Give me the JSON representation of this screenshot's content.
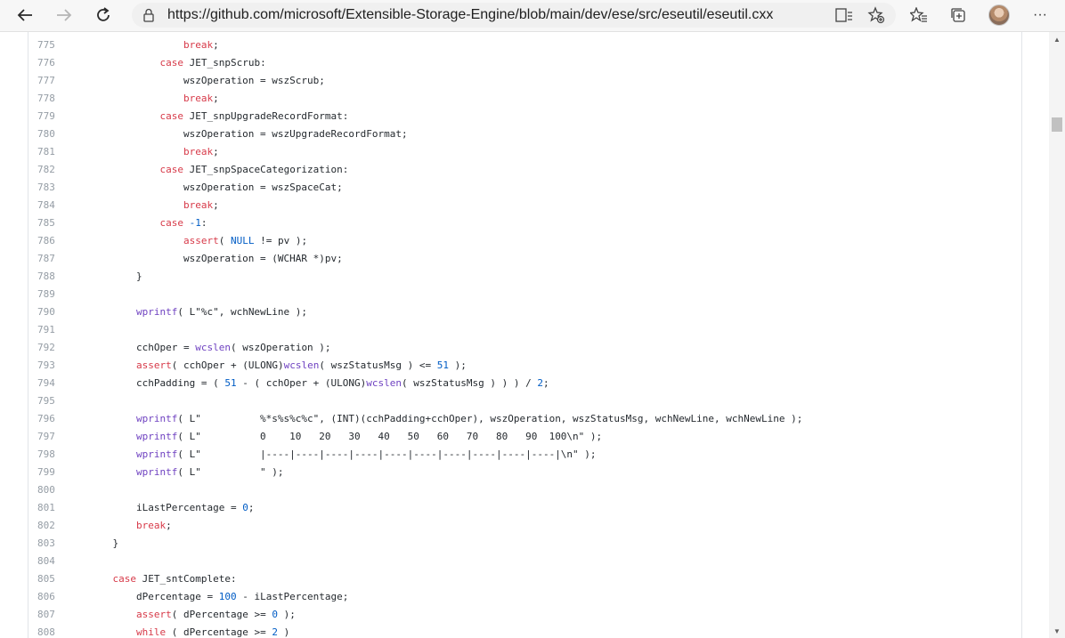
{
  "browser": {
    "url": "https://github.com/microsoft/Extensible-Storage-Engine/blob/main/dev/ese/src/eseutil/eseutil.cxx"
  },
  "code": {
    "lines": [
      {
        "n": "775",
        "src": "                break;"
      },
      {
        "n": "776",
        "src": "            case JET_snpScrub:"
      },
      {
        "n": "777",
        "src": "                wszOperation = wszScrub;"
      },
      {
        "n": "778",
        "src": "                break;"
      },
      {
        "n": "779",
        "src": "            case JET_snpUpgradeRecordFormat:"
      },
      {
        "n": "780",
        "src": "                wszOperation = wszUpgradeRecordFormat;"
      },
      {
        "n": "781",
        "src": "                break;"
      },
      {
        "n": "782",
        "src": "            case JET_snpSpaceCategorization:"
      },
      {
        "n": "783",
        "src": "                wszOperation = wszSpaceCat;"
      },
      {
        "n": "784",
        "src": "                break;"
      },
      {
        "n": "785",
        "src": "            case -1:"
      },
      {
        "n": "786",
        "src": "                assert( NULL != pv );"
      },
      {
        "n": "787",
        "src": "                wszOperation = (WCHAR *)pv;"
      },
      {
        "n": "788",
        "src": "        }"
      },
      {
        "n": "789",
        "src": ""
      },
      {
        "n": "790",
        "src": "        wprintf( L\"%c\", wchNewLine );"
      },
      {
        "n": "791",
        "src": ""
      },
      {
        "n": "792",
        "src": "        cchOper = wcslen( wszOperation );"
      },
      {
        "n": "793",
        "src": "        assert( cchOper + (ULONG)wcslen( wszStatusMsg ) <= 51 );"
      },
      {
        "n": "794",
        "src": "        cchPadding = ( 51 - ( cchOper + (ULONG)wcslen( wszStatusMsg ) ) ) / 2;"
      },
      {
        "n": "795",
        "src": ""
      },
      {
        "n": "796",
        "src": "        wprintf( L\"          %*s%s%c%c\", (INT)(cchPadding+cchOper), wszOperation, wszStatusMsg, wchNewLine, wchNewLine );"
      },
      {
        "n": "797",
        "src": "        wprintf( L\"          0    10   20   30   40   50   60   70   80   90  100\\n\" );"
      },
      {
        "n": "798",
        "src": "        wprintf( L\"          |----|----|----|----|----|----|----|----|----|----|\\n\" );"
      },
      {
        "n": "799",
        "src": "        wprintf( L\"          \" );"
      },
      {
        "n": "800",
        "src": ""
      },
      {
        "n": "801",
        "src": "        iLastPercentage = 0;"
      },
      {
        "n": "802",
        "src": "        break;"
      },
      {
        "n": "803",
        "src": "    }"
      },
      {
        "n": "804",
        "src": ""
      },
      {
        "n": "805",
        "src": "    case JET_sntComplete:"
      },
      {
        "n": "806",
        "src": "        dPercentage = 100 - iLastPercentage;"
      },
      {
        "n": "807",
        "src": "        assert( dPercentage >= 0 );"
      },
      {
        "n": "808",
        "src": "        while ( dPercentage >= 2 )"
      }
    ]
  },
  "icons": {
    "back": "back-arrow-icon",
    "forward": "forward-arrow-icon",
    "refresh": "refresh-icon",
    "lock": "lock-icon",
    "reader": "immersive-reader-icon",
    "add_favorite": "add-favorite-icon",
    "favorites": "favorites-icon",
    "collections": "collections-icon",
    "profile": "profile-avatar",
    "menu": "more-menu-icon"
  },
  "menu_glyph": "···",
  "colors": {
    "keyword": "#d73a49",
    "function": "#6f42c1",
    "number": "#005cc5",
    "line_number": "#959da5"
  }
}
